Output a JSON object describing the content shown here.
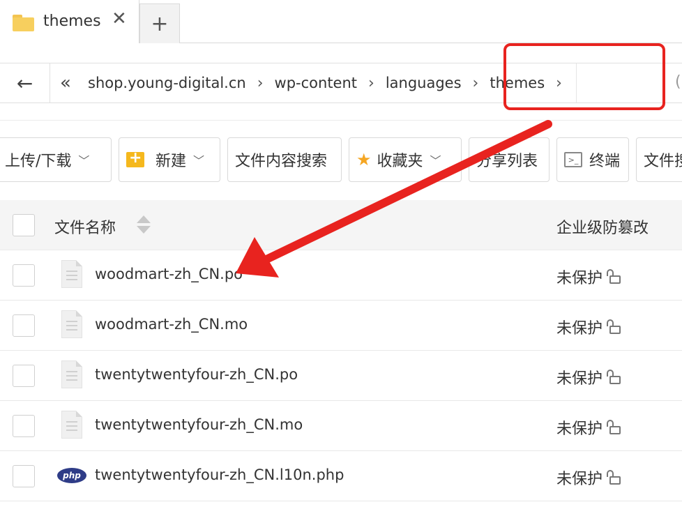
{
  "tab": {
    "title": "themes",
    "close": "✕",
    "new_tab": "+"
  },
  "address": {
    "back": "←",
    "collapse": "«",
    "crumbs": [
      "shop.young-digital.cn",
      "wp-content",
      "languages",
      "themes"
    ],
    "sep": "›",
    "edge_char": "("
  },
  "toolbar": {
    "upload": "上传/下载",
    "new": "新建",
    "content_search": "文件内容搜索",
    "favorites": "收藏夹",
    "share_list": "分享列表",
    "terminal": "终端",
    "more": "文件搜"
  },
  "table": {
    "col_name": "文件名称",
    "col_protect": "企业级防篡改",
    "rows": [
      {
        "name": "woodmart-zh_CN.po",
        "status": "未保护",
        "icon": "file-icon"
      },
      {
        "name": "woodmart-zh_CN.mo",
        "status": "未保护",
        "icon": "file-icon"
      },
      {
        "name": "twentytwentyfour-zh_CN.po",
        "status": "未保护",
        "icon": "file-icon"
      },
      {
        "name": "twentytwentyfour-zh_CN.mo",
        "status": "未保护",
        "icon": "file-icon"
      },
      {
        "name": "twentytwentyfour-zh_CN.l10n.php",
        "status": "未保护",
        "icon": "php-icon",
        "icon_text": "php"
      }
    ]
  },
  "colors": {
    "annotation": "#e8231f",
    "folder": "#f7cf5e",
    "php": "#2e3c87"
  }
}
